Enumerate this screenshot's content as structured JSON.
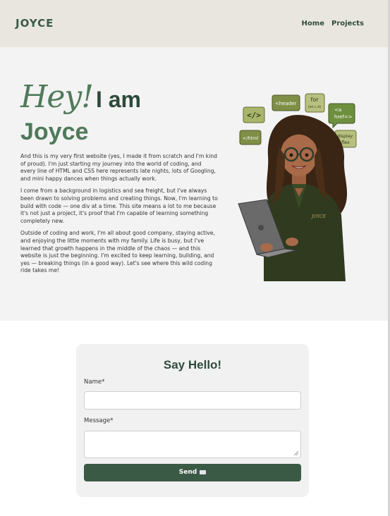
{
  "header": {
    "logo": "JOYCE",
    "nav": [
      "Home",
      "Projects"
    ]
  },
  "hero": {
    "hey": "Hey!",
    "iam": "I am",
    "name": "Joyce",
    "paragraphs": [
      "And this is my very first website (yes, I made it from scratch and I'm kind of proud). I'm just starting my journey into the world of coding, and every line of HTML and CSS here represents late nights, lots of Googling, and mini happy dances when things actually work.",
      "I come from a background in logistics and sea freight, but I've always been drawn to solving problems and creating things. Now, I'm learning to build with code — one div at a time. This site means a lot to me because it's not just a project, it's proof that I'm capable of learning something completely new.",
      "Outside of coding and work, I'm all about good company, staying active, and enjoying the little moments with my family. Life is busy, but I've learned that growth happens in the middle of the chaos — and this website is just the beginning. I'm excited to keep learning, building, and yes — breaking things (in a good way). Let's see where this wild coding ride takes me!"
    ],
    "bubbles": {
      "b1": "</>",
      "b2": "<header",
      "b3a": "for",
      "b3b": "(let i=0)",
      "b4a": "<a",
      "b4b": "href=>",
      "b5": "</html",
      "b6a": "display:",
      "b6b": "flex"
    },
    "jacket_text": "JOYCE"
  },
  "form": {
    "title": "Say Hello!",
    "name_label": "Name*",
    "message_label": "Message*",
    "name_value": "",
    "message_value": "",
    "send_label": "Send"
  }
}
